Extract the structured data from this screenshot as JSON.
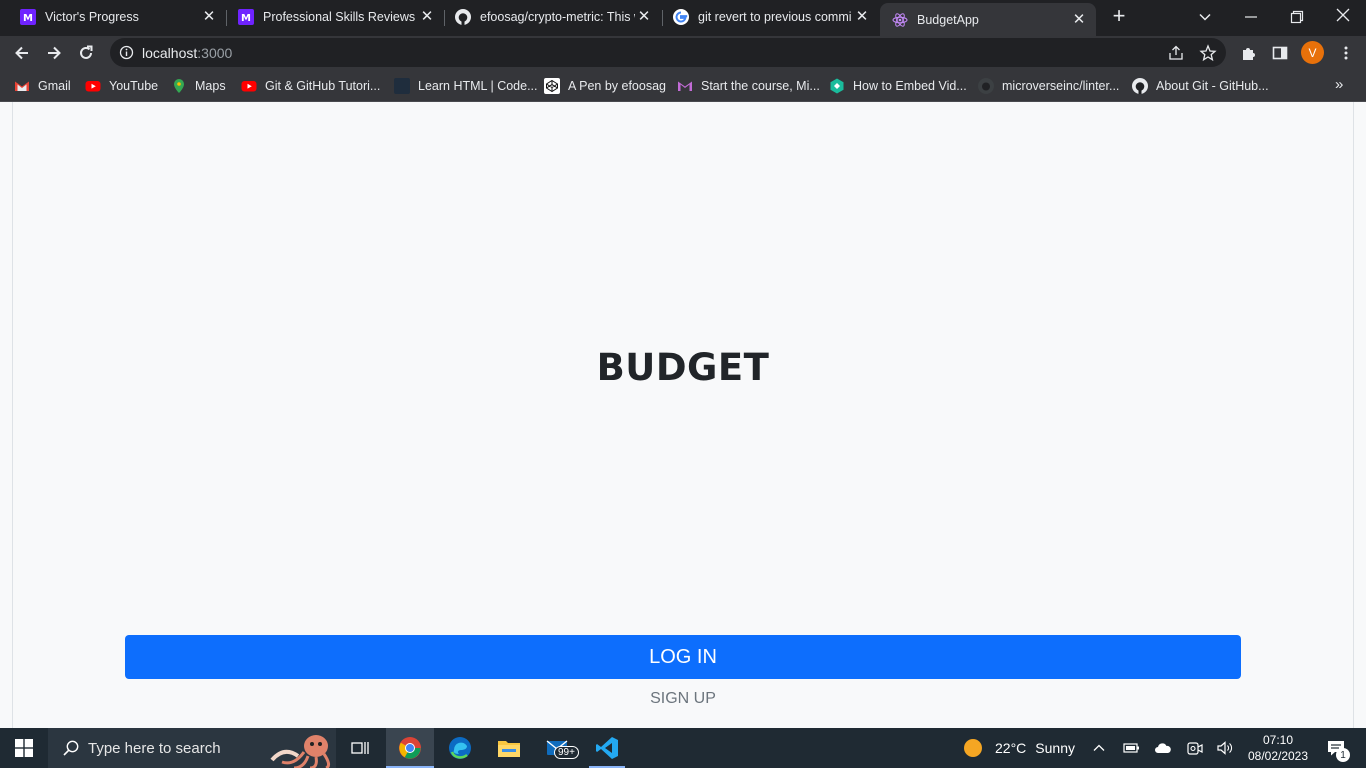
{
  "browser": {
    "tabs": [
      {
        "title": "Victor's Progress",
        "favicon": "microverse-icon",
        "active": false
      },
      {
        "title": "Professional Skills Reviews",
        "favicon": "microverse-icon",
        "active": false
      },
      {
        "title": "efoosag/crypto-metric: This w",
        "favicon": "github-icon",
        "active": false
      },
      {
        "title": "git revert to previous commi",
        "favicon": "google-icon",
        "active": false
      },
      {
        "title": "BudgetApp",
        "favicon": "react-icon",
        "active": true
      }
    ],
    "new_tab_label": "+",
    "url_host": "localhost",
    "url_port": ":3000",
    "profile_initial": "V",
    "bookmarks": [
      {
        "label": "Gmail",
        "icon": "gmail-icon"
      },
      {
        "label": "YouTube",
        "icon": "youtube-icon"
      },
      {
        "label": "Maps",
        "icon": "maps-icon"
      },
      {
        "label": "Git & GitHub Tutori...",
        "icon": "youtube-icon"
      },
      {
        "label": "Learn HTML | Code...",
        "icon": "codecademy-icon"
      },
      {
        "label": "A Pen by efoosag",
        "icon": "codepen-icon"
      },
      {
        "label": "Start the course, Mi...",
        "icon": "gmail-icon"
      },
      {
        "label": "How to Embed Vid...",
        "icon": "hexagon-icon"
      },
      {
        "label": "microverseinc/linter...",
        "icon": "github-icon"
      },
      {
        "label": "About Git - GitHub...",
        "icon": "github-icon"
      }
    ]
  },
  "page": {
    "title": "BUDGET",
    "login_label": "LOG IN",
    "signup_label": "SIGN UP"
  },
  "taskbar": {
    "search_placeholder": "Type here to search",
    "mail_badge": "99+",
    "weather_temp": "22°C",
    "weather_desc": "Sunny",
    "time": "07:10",
    "date": "08/02/2023",
    "notification_count": "1"
  },
  "colors": {
    "primary": "#0d6efd",
    "page_bg": "#f8f9fa",
    "chrome_dark": "#202124",
    "chrome_toolbar": "#35363a"
  }
}
